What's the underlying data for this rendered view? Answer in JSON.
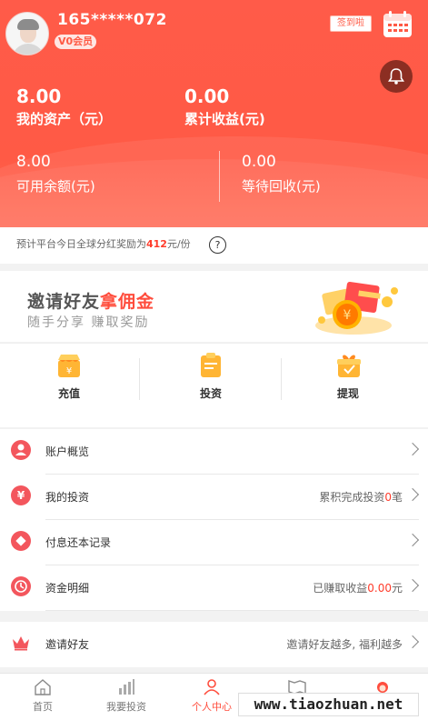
{
  "header": {
    "username": "165*****072",
    "vip_badge": "V0会员",
    "checkin_label": "签到啦",
    "total_assets_value": "8.00",
    "total_assets_label": "我的资产（元）",
    "cumulative_income_value": "0.00",
    "cumulative_income_label": "累计收益(元)",
    "available_balance_value": "8.00",
    "available_balance_label": "可用余额(元)",
    "pending_return_value": "0.00",
    "pending_return_label": "等待回收(元)"
  },
  "notice": {
    "prefix": "预计平台今日全球分红奖励为",
    "amount": "412",
    "suffix": "元/份",
    "help_icon": "?"
  },
  "banner": {
    "title_part1": "邀请好友",
    "title_part2": "拿佣金",
    "subtitle": "随手分享 赚取奖励"
  },
  "actions": [
    {
      "label": "充值"
    },
    {
      "label": "投资"
    },
    {
      "label": "提现"
    }
  ],
  "menu": {
    "account_overview": {
      "label": "账户概览"
    },
    "my_investment": {
      "label": "我的投资",
      "right_prefix": "累积完成投资",
      "right_count": "0",
      "right_suffix": "笔"
    },
    "interest_record": {
      "label": "付息还本记录"
    },
    "fund_details": {
      "label": "资金明细",
      "right_prefix": "已赚取收益",
      "right_amount": "0.00",
      "right_suffix": "元"
    },
    "invite": {
      "label": "邀请好友",
      "right_text": "邀请好友越多, 福利越多"
    }
  },
  "tabbar": {
    "home": "首页",
    "invest": "我要投资",
    "profile": "个人中心"
  },
  "watermark": "www.tiaozhuan.net",
  "colors": {
    "brand": "#ff5a45",
    "accent": "#ff3b2a"
  }
}
